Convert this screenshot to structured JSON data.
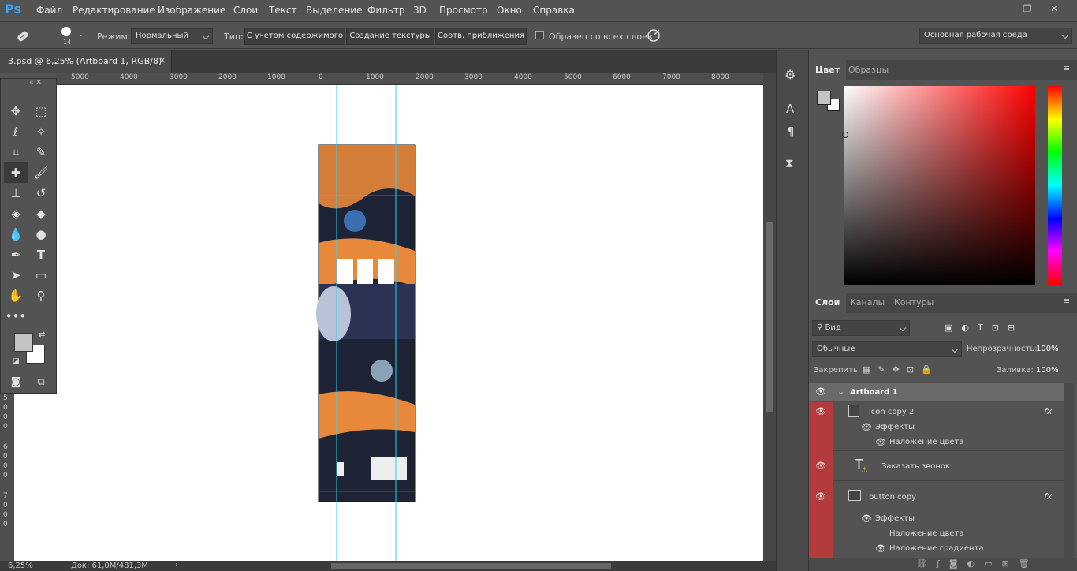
{
  "menu": {
    "logo": "Ps",
    "items": [
      "Файл",
      "Редактирование",
      "Изображение",
      "Слои",
      "Текст",
      "Выделение",
      "Фильтр",
      "3D",
      "Просмотр",
      "Окно",
      "Справка"
    ],
    "min": "–",
    "restore": "❐",
    "close": "✕"
  },
  "options": {
    "brush_size": "14",
    "mode_label": "Режим:",
    "mode_value": "Нормальный",
    "type_label": "Тип:",
    "btn_content": "С учетом содержимого",
    "btn_texture": "Создание текстуры",
    "btn_proximity": "Соотв. приближения",
    "sample_all": "Образец со всех слоев",
    "workspace": "Основная рабочая среда"
  },
  "document": {
    "tab_title": "3.psd @ 6,25% (Artboard 1, RGB/8)",
    "tab_close": "×"
  },
  "ruler": {
    "h_labels": [
      "5000",
      "4000",
      "3000",
      "2000",
      "1000",
      "0",
      "1000",
      "2000",
      "3000",
      "4000",
      "5000",
      "6000",
      "7000",
      "8000"
    ],
    "v_labels": [
      "5",
      "0",
      "0",
      "0",
      "6",
      "0",
      "0",
      "0",
      "7",
      "0",
      "0",
      "0"
    ]
  },
  "status": {
    "zoom": "6,25%",
    "doc": "Док: 61,0M/481,3M"
  },
  "color_panel": {
    "tabs": [
      "Цвет",
      "Образцы"
    ]
  },
  "layers_panel": {
    "tabs": [
      "Слои",
      "Каналы",
      "Контуры"
    ],
    "filter": "Вид",
    "blend": "Обычные",
    "opacity_label": "Непрозрачность:",
    "opacity": "100%",
    "lock_label": "Закрепить:",
    "fill_label": "Заливка:",
    "fill": "100%"
  },
  "layers": {
    "artboard": "Artboard 1",
    "l1_name": "icon copy 2",
    "l1_effects": "Эффекты",
    "l1_overlay": "Наложение цвета",
    "l2_name": "Заказать звонок",
    "l3_name": "button copy",
    "l3_effects": "Эффекты",
    "l3_overlay": "Наложение цвета",
    "l3_gradient": "Наложение градиента",
    "fx": "fx"
  },
  "colors": {
    "accent": "#e8883a",
    "dark": "#1e2436",
    "layer_red": "#b33b3b",
    "guide": "#2fd1ee"
  }
}
